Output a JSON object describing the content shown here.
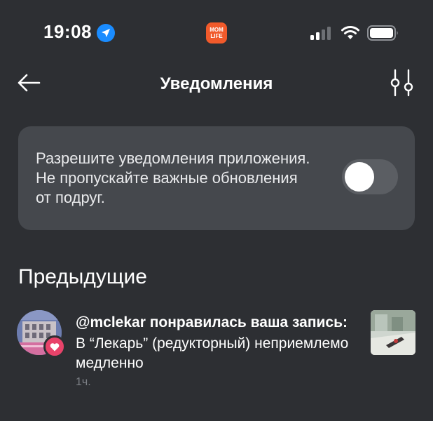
{
  "status_bar": {
    "time": "19:08",
    "app_badge_text": "MOM LIFE",
    "app_badge_line1": "MOM",
    "app_badge_line2": "LIFE"
  },
  "header": {
    "title": "Уведомления",
    "back_icon": "arrow-left-icon",
    "filter_icon": "sliders-icon"
  },
  "permission_card": {
    "text": "Разрешите уведомления приложения. Не пропускайте важные обновления от подруг.",
    "toggle_on": false
  },
  "section": {
    "title": "Предыдущие"
  },
  "notifications": [
    {
      "title": "@mclekar понравилась ваша запись:",
      "text": "В “Лекарь” (редукторный) неприемлемо медленно",
      "time": "1ч.",
      "badge_icon": "heart-icon"
    }
  ],
  "colors": {
    "background": "#2d2f33",
    "card": "#45484d",
    "heart_badge": "#e8436a",
    "app_badge": "#f15a2b",
    "location_icon": "#1a8cff"
  }
}
